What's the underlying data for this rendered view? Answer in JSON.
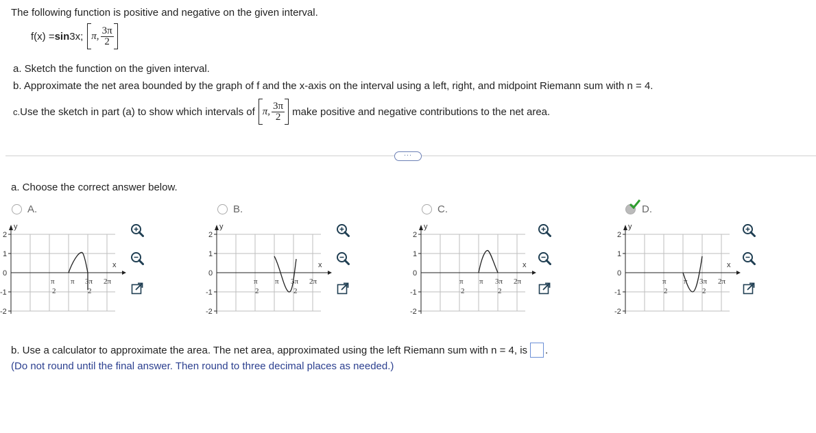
{
  "intro": "The following function is positive and negative on the given interval.",
  "function_def": {
    "prefix": "f(x) = ",
    "bold": "sin",
    "suffix": " 3x;",
    "interval_start": "π,",
    "frac_num": "3π",
    "frac_den": "2"
  },
  "part_a_prompt": "a. Sketch the function on the given interval.",
  "part_b_prompt": "b. Approximate the net area bounded by the graph of f and the x-axis on the interval using a left, right, and midpoint Riemann sum with n = 4.",
  "part_c_prompt": {
    "letter": "c.",
    "before": " Use the sketch in part (a) to show which intervals of",
    "interval_start": "π,",
    "frac_num": "3π",
    "frac_den": "2",
    "after": "make positive and negative contributions to the net area."
  },
  "more_button": "···",
  "question_a": "a. Choose the correct answer below.",
  "options": [
    {
      "label": "A.",
      "selected": false
    },
    {
      "label": "B.",
      "selected": false
    },
    {
      "label": "C.",
      "selected": false
    },
    {
      "label": "D.",
      "selected": true
    }
  ],
  "graph_labels": {
    "y": "y",
    "x": "x",
    "y_ticks": [
      "2",
      "1",
      "0",
      "-1",
      "-2"
    ],
    "x_ticks": [
      "π",
      "2",
      "π",
      "3π",
      "2",
      "2π"
    ]
  },
  "icons": [
    "zoom-in-icon",
    "zoom-out-icon",
    "open-new-window-icon",
    "check-mark-icon"
  ],
  "colors": {
    "check_green": "#2e9e2e",
    "link_blue": "#2b3f8f",
    "answer_border": "#6b8fd6"
  },
  "question_b": {
    "text": "b. Use a calculator to approximate the area. The net area, approximated using the left Riemann sum with n = 4, is",
    "period": ".",
    "hint": "(Do not round until the final answer. Then round to three decimal places as needed.)"
  }
}
